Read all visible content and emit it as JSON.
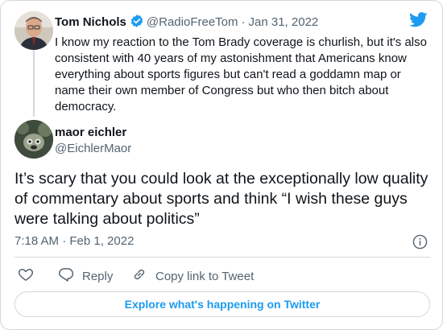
{
  "parent_tweet": {
    "display_name": "Tom Nichols",
    "handle": "@RadioFreeTom",
    "separator": "·",
    "date": "Jan 31, 2022",
    "text": "I know my reaction to the Tom Brady coverage is churlish, but it's also consistent with 40 years of my astonishment that Americans know everything about sports figures but can't read a goddamn map or name their own member of Congress but who then bitch about democracy."
  },
  "tweet": {
    "display_name": "maor eichler",
    "handle": "@EichlerMaor",
    "text": "It’s scary that you could look at the exceptionally low quality of commentary about sports and think “I wish these guys were talking about politics”",
    "timestamp": "7:18 AM · Feb 1, 2022"
  },
  "actions": {
    "reply_label": "Reply",
    "copy_label": "Copy link to Tweet"
  },
  "explore_label": "Explore what's happening on Twitter",
  "colors": {
    "accent": "#1d9bf0",
    "text": "#0f1419",
    "secondary": "#536471",
    "border": "#cfd9de"
  },
  "icons": [
    "verified-badge-icon",
    "twitter-bird-icon",
    "info-icon",
    "heart-icon",
    "reply-icon",
    "link-icon"
  ]
}
